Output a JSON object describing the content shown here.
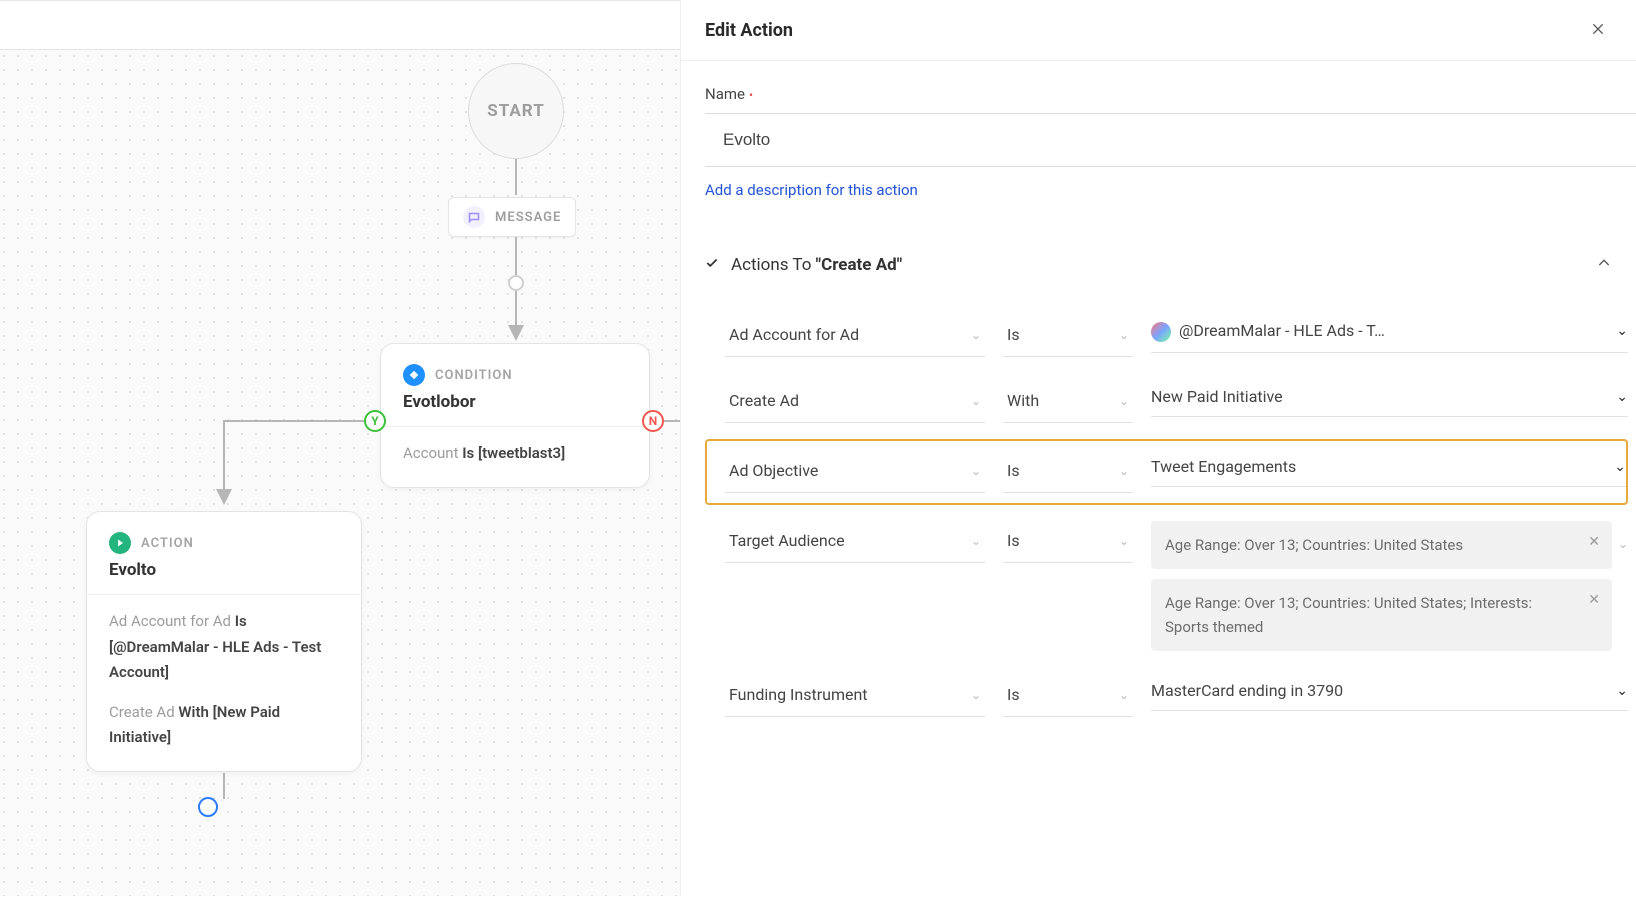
{
  "canvas": {
    "start_label": "START",
    "message_pill": "MESSAGE",
    "condition": {
      "type_label": "CONDITION",
      "title": "Evotlobor",
      "body_prefix": "Account ",
      "body_mid": "Is ",
      "body_suffix": "[tweetblast3]"
    },
    "action": {
      "type_label": "ACTION",
      "title": "Evolto",
      "line1_a": "Ad Account for Ad ",
      "line1_b": "Is ",
      "line1_c": "[@DreamMalar - HLE Ads - Test Account]",
      "line2_a": "Create Ad ",
      "line2_b": "With ",
      "line2_c": "[New Paid Initiative]"
    },
    "y_label": "Y",
    "n_label": "N"
  },
  "panel": {
    "title": "Edit Action",
    "name_label": "Name",
    "name_value": "Evolto",
    "add_desc": "Add a description for this action",
    "section_prefix": "Actions To ",
    "section_bold": "\"Create Ad\"",
    "rows": {
      "r1": {
        "a": "Ad Account for Ad",
        "b": "Is",
        "c": "@DreamMalar - HLE Ads - T…"
      },
      "r2": {
        "a": "Create Ad",
        "b": "With",
        "c": "New Paid Initiative"
      },
      "r3": {
        "a": "Ad Objective",
        "b": "Is",
        "c": "Tweet Engagements"
      },
      "r4": {
        "a": "Target Audience",
        "b": "Is"
      },
      "r5": {
        "a": "Funding Instrument",
        "b": "Is",
        "c": "MasterCard ending in 3790"
      }
    },
    "tags": {
      "t1": "Age Range: Over 13; Countries: United States",
      "t2": "Age Range: Over 13; Countries: United States; Interests: Sports themed"
    }
  }
}
